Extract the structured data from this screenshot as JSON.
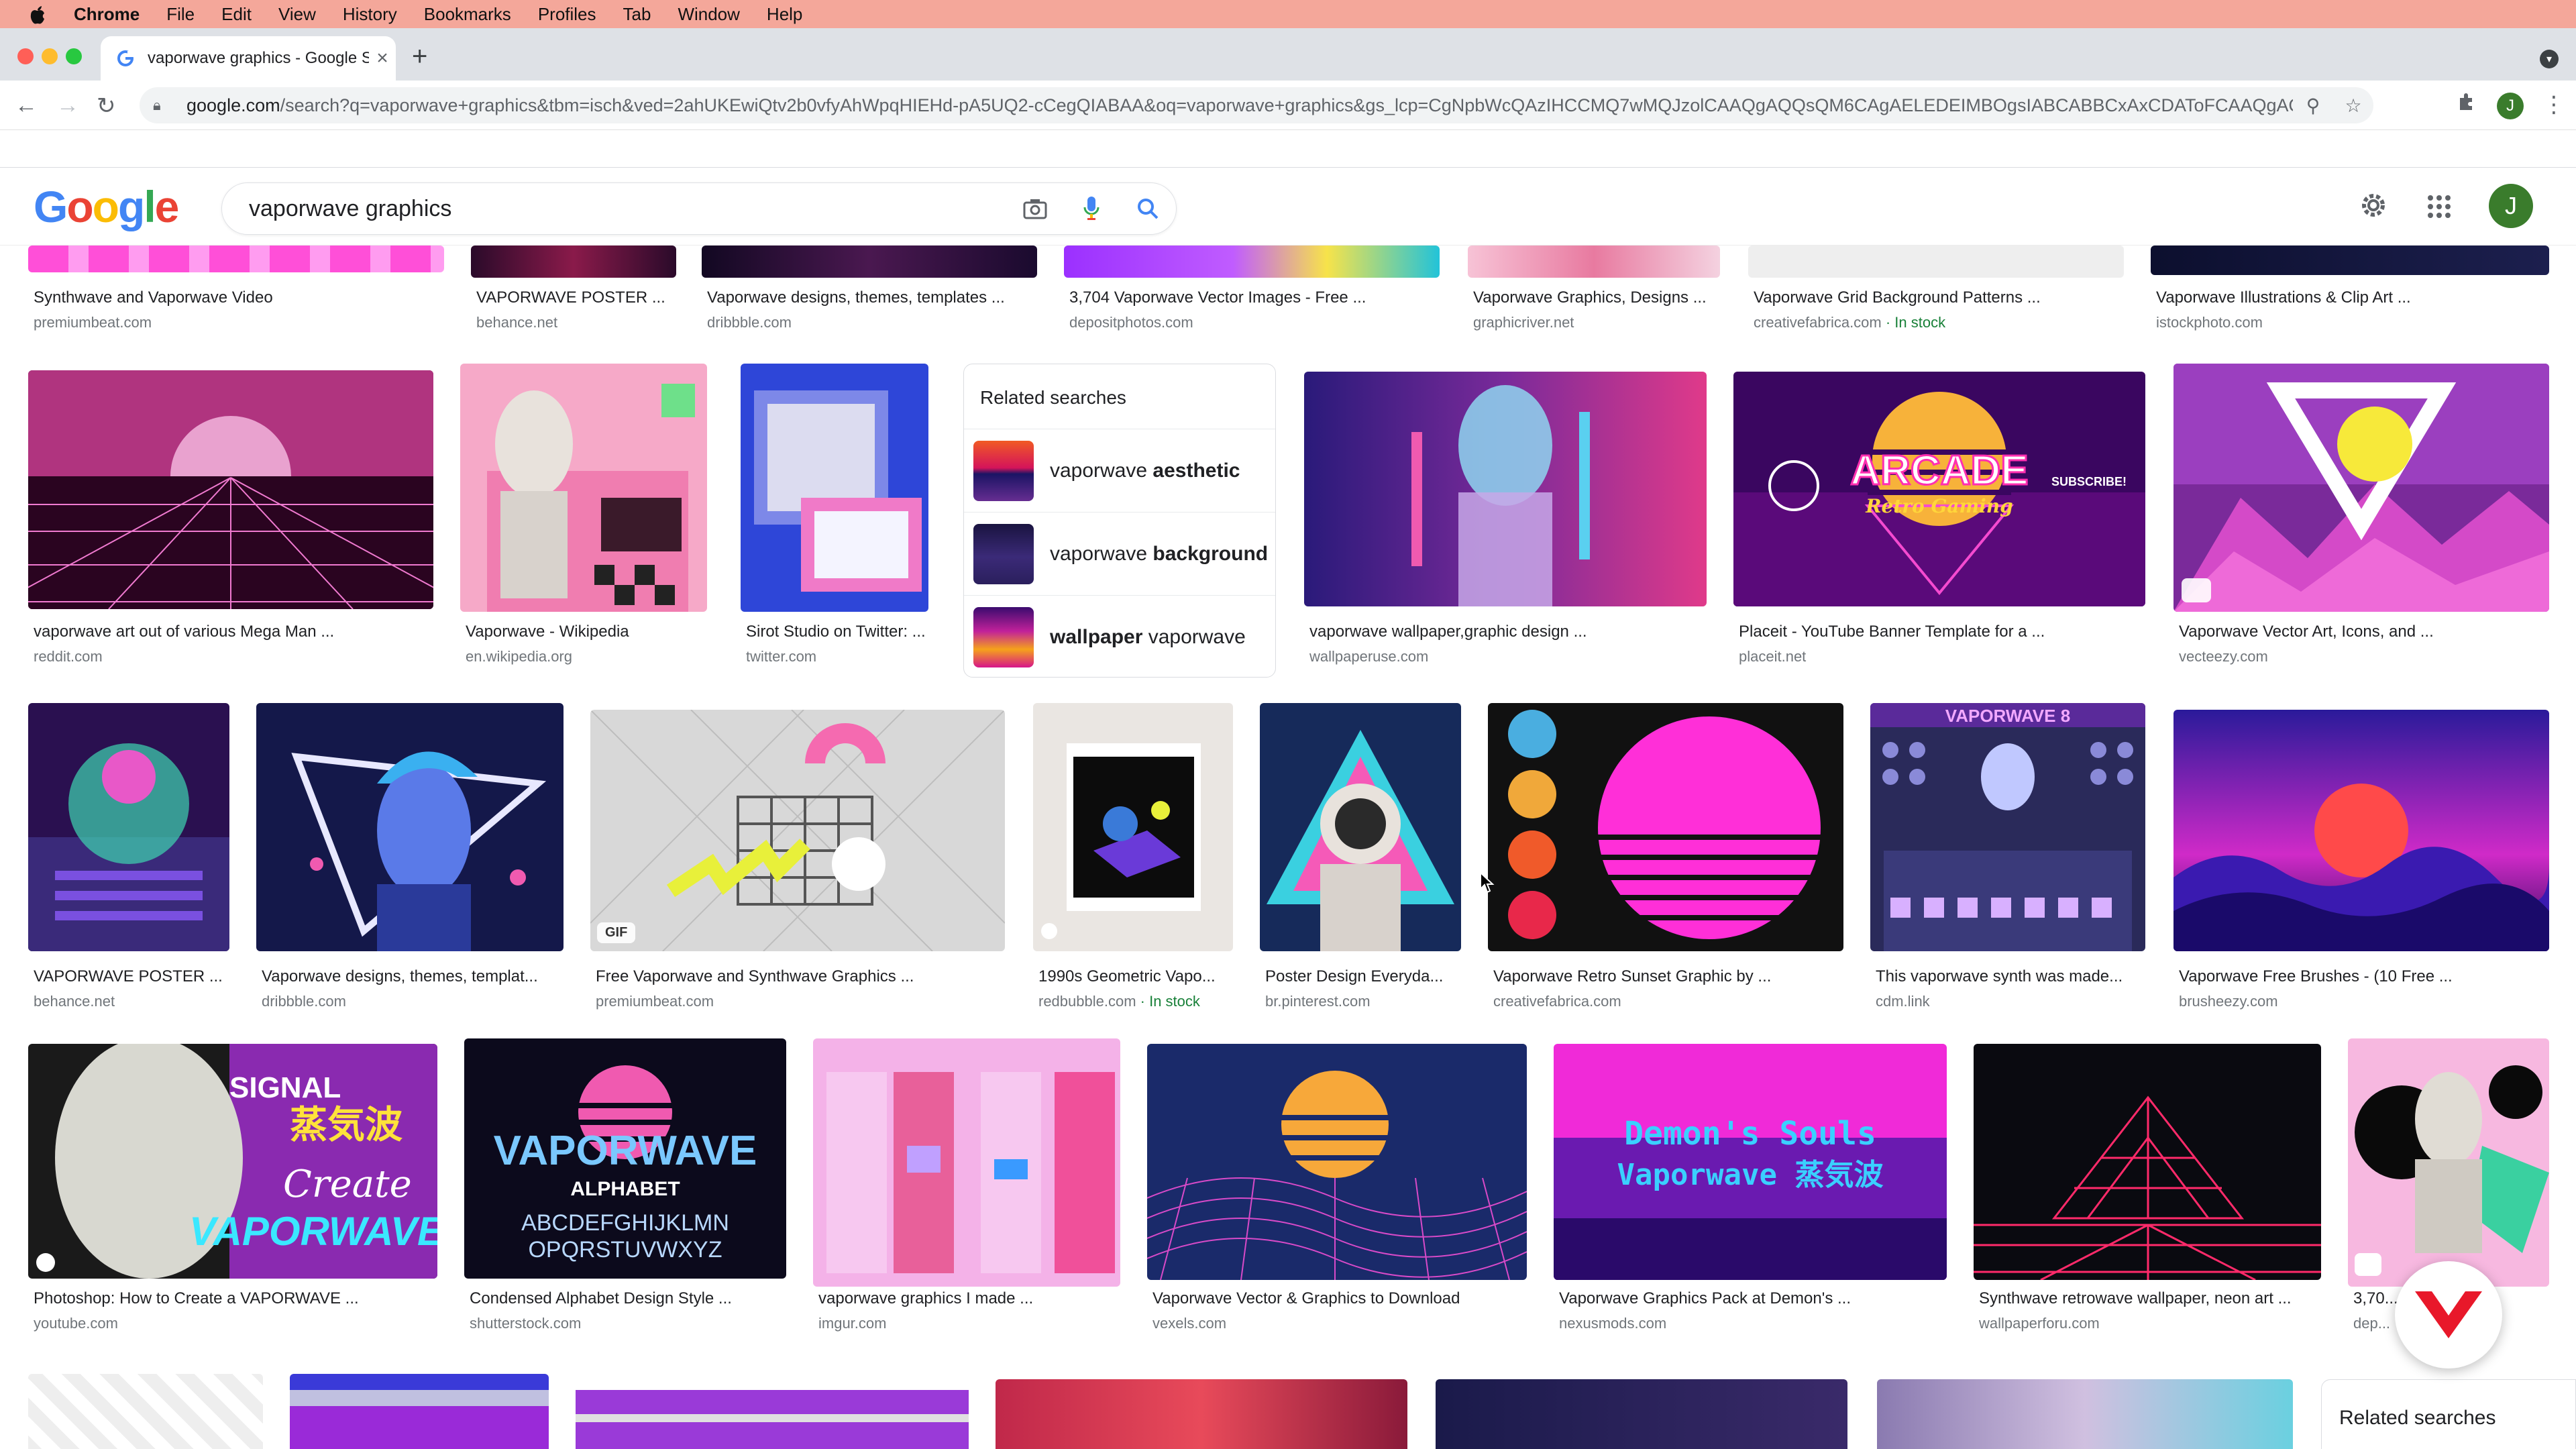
{
  "menubar": {
    "app": "Chrome",
    "items": [
      "File",
      "Edit",
      "View",
      "History",
      "Bookmarks",
      "Profiles",
      "Tab",
      "Window",
      "Help"
    ]
  },
  "browser": {
    "tab_title": "vaporwave graphics - Google S",
    "url_domain": "google.com",
    "url_rest": "/search?q=vaporwave+graphics&tbm=isch&ved=2ahUKEwiQtv2b0vfyAhWpqHIEHd-pA5UQ2-cCegQIABAA&oq=vaporwave+graphics&gs_lcp=CgNpbWcQAzIHCCMQ7wMQJzolCAAQgAQQsQM6CAgAELEDEIMBOgsIABCABBCxAxCDAToFCAAQgAQ6BwgA...",
    "profile_initial": "J"
  },
  "google": {
    "logo": "Google",
    "query": "vaporwave graphics",
    "profile_initial": "J"
  },
  "colors": {
    "menubar": "#f4a79a",
    "accent_blue": "#4285f4",
    "in_stock": "#188038"
  },
  "row0": [
    {
      "title": "Synthwave and Vaporwave Video",
      "source": "premiumbeat.com"
    },
    {
      "title": "VAPORWAVE POSTER ...",
      "source": "behance.net"
    },
    {
      "title": "Vaporwave designs, themes, templates ...",
      "source": "dribbble.com"
    },
    {
      "title": "3,704 Vaporwave Vector Images - Free ...",
      "source": "depositphotos.com"
    },
    {
      "title": "Vaporwave Graphics, Designs ...",
      "source": "graphicriver.net"
    },
    {
      "title": "Vaporwave Grid Background Patterns ...",
      "source": "creativefabrica.com",
      "stock": " · In stock"
    },
    {
      "title": "Vaporwave Illustrations & Clip Art ...",
      "source": "istockphoto.com"
    }
  ],
  "row1": [
    {
      "title": "vaporwave art out of various Mega Man ...",
      "source": "reddit.com"
    },
    {
      "title": "Vaporwave - Wikipedia",
      "source": "en.wikipedia.org"
    },
    {
      "title": "Sirot Studio on Twitter: ...",
      "source": "twitter.com"
    },
    {
      "title": "vaporwave wallpaper,graphic design ...",
      "source": "wallpaperuse.com"
    },
    {
      "title": "Placeit - YouTube Banner Template for a ...",
      "source": "placeit.net"
    },
    {
      "title": "Vaporwave Vector Art, Icons, and ...",
      "source": "vecteezy.com"
    }
  ],
  "related": {
    "heading": "Related searches",
    "items": [
      {
        "plain": "vaporwave ",
        "bold": "aesthetic",
        "bold_first": false
      },
      {
        "plain": "vaporwave ",
        "bold": "background",
        "bold_first": false
      },
      {
        "plain": " vaporwave",
        "bold": "wallpaper",
        "bold_first": true
      }
    ]
  },
  "row2": [
    {
      "title": "VAPORWAVE POSTER ...",
      "source": "behance.net"
    },
    {
      "title": "Vaporwave designs, themes, templat...",
      "source": "dribbble.com"
    },
    {
      "title": "Free Vaporwave and Synthwave Graphics ...",
      "source": "premiumbeat.com",
      "badge": "GIF"
    },
    {
      "title": "1990s Geometric Vapo...",
      "source": "redbubble.com",
      "stock": " · In stock"
    },
    {
      "title": "Poster Design Everyda...",
      "source": "br.pinterest.com"
    },
    {
      "title": "Vaporwave Retro Sunset Graphic by ...",
      "source": "creativefabrica.com"
    },
    {
      "title": "This vaporwave synth was made...",
      "source": "cdm.link"
    },
    {
      "title": "Vaporwave Free Brushes - (10 Free ...",
      "source": "brusheezy.com"
    }
  ],
  "row3": [
    {
      "title": "Photoshop: How to Create a VAPORWAVE ...",
      "source": "youtube.com"
    },
    {
      "title": "Condensed Alphabet Design Style ...",
      "source": "shutterstock.com"
    },
    {
      "title": "vaporwave graphics I made ...",
      "source": "imgur.com"
    },
    {
      "title": "Vaporwave Vector & Graphics to Download",
      "source": "vexels.com"
    },
    {
      "title": "Vaporwave Graphics Pack at Demon's ...",
      "source": "nexusmods.com"
    },
    {
      "title": "Synthwave retrowave wallpaper, neon art ...",
      "source": "wallpaperforu.com"
    },
    {
      "title": "3,70...",
      "source": "dep..."
    }
  ],
  "thumb_text": {
    "signal": "SIGNAL",
    "create": "Create",
    "vaporwave": "VAPORWAVE",
    "jp": "蒸気波",
    "alphabet": "ALPHABET",
    "letters1": "ABCDEFGHIJKLMN",
    "letters2": "OPQRSTUVWXYZ",
    "arcade": "ARCADE",
    "retro": "Retro Gaming",
    "subscribe": "SUBSCRIBE!",
    "demons1": "Demon's Souls",
    "demons2": "Vaporwave 蒸気波",
    "synth": "VAPORWAVE 8"
  },
  "related2": "Related searches"
}
